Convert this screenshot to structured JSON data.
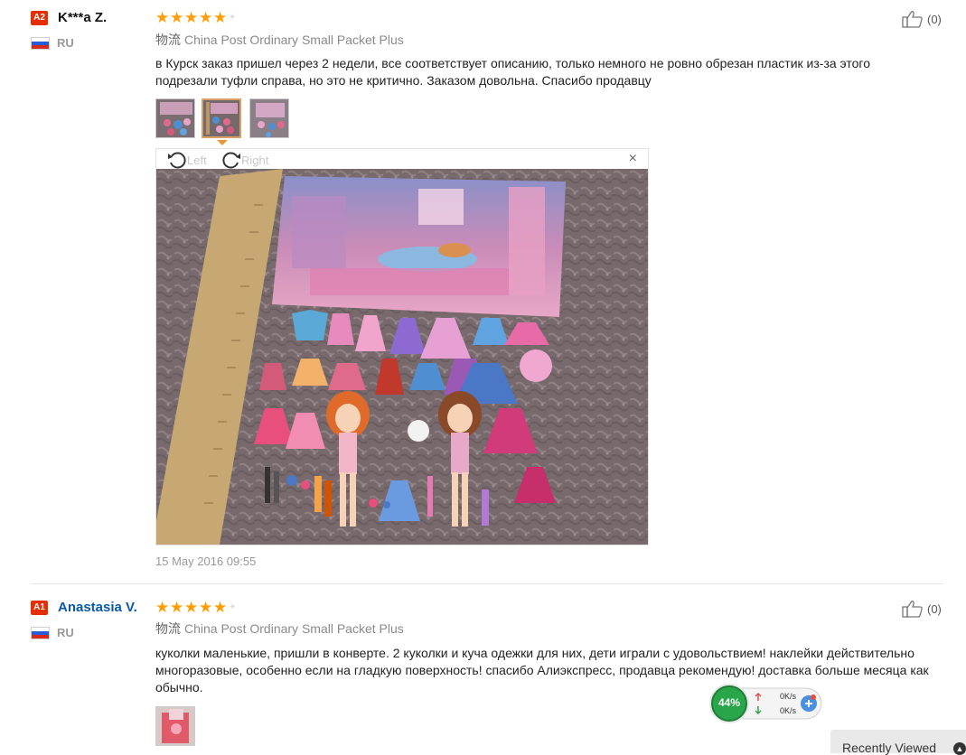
{
  "reviews": [
    {
      "level": "A2",
      "username": "K***a Z.",
      "country": "RU",
      "stars": [
        "★",
        "★",
        "★",
        "★",
        "★"
      ],
      "rating": 5,
      "shipping_label": "物流",
      "shipping_method": "China Post Ordinary Small Packet Plus",
      "text": "в Курск заказ пришел через 2 недели, все соответствует описанию, только немного не ровно обрезан пластик из-за этого подрезали туфли справа, но это не критично. Заказом довольна. Спасибо продавцу",
      "helpful_count": "(0)",
      "viewer": {
        "rotate_left": "Left",
        "rotate_right": "Right",
        "close": "×"
      },
      "date": "15 May 2016 09:55"
    },
    {
      "level": "A1",
      "username": "Anastasia V.",
      "country": "RU",
      "stars": [
        "★",
        "★",
        "★",
        "★",
        "★"
      ],
      "rating": 5,
      "shipping_label": "物流",
      "shipping_method": "China Post Ordinary Small Packet Plus",
      "text": "куколки маленькие, пришли в конверте. 2 куколки и куча одежки для них, дети играли с удовольствием! наклейки действительно многоразовые, особенно если на гладкую поверхность! спасибо Алиэкспресс, продавца рекомендую! доставка больше месяца как обычно.",
      "helpful_count": "(0)"
    }
  ],
  "speed_widget": {
    "percent": "44%",
    "upload": "0K/s",
    "download": "0K/s",
    "accent": "#2aa64a"
  },
  "recently_viewed": {
    "label": "Recently Viewed"
  },
  "colors": {
    "star": "#ff9c00",
    "badge": "#e62e04",
    "link": "#0a58a8"
  }
}
